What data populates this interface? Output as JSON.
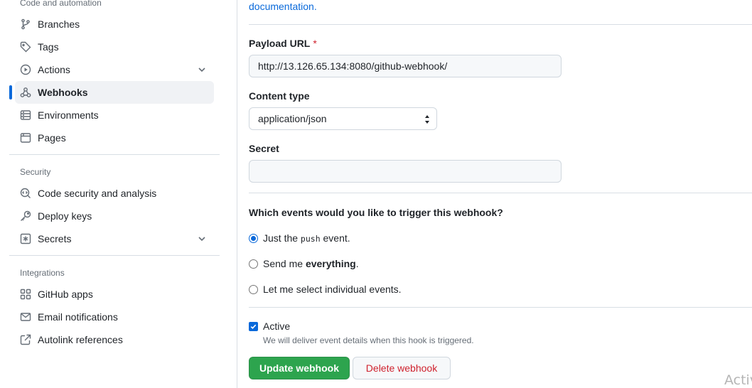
{
  "sidebar": {
    "code_section": "Code and automation",
    "code_items": [
      {
        "label": "Branches",
        "icon": "branch-icon"
      },
      {
        "label": "Tags",
        "icon": "tag-icon"
      },
      {
        "label": "Actions",
        "icon": "play-icon"
      },
      {
        "label": "Webhooks",
        "icon": "webhook-icon",
        "active": true
      },
      {
        "label": "Environments",
        "icon": "server-icon"
      },
      {
        "label": "Pages",
        "icon": "browser-icon"
      }
    ],
    "security_section": "Security",
    "security_items": [
      {
        "label": "Code security and analysis",
        "icon": "codescan-icon"
      },
      {
        "label": "Deploy keys",
        "icon": "key-icon"
      },
      {
        "label": "Secrets",
        "icon": "asterisk-icon"
      }
    ],
    "integrations_section": "Integrations",
    "integrations_items": [
      {
        "label": "GitHub apps",
        "icon": "apps-icon"
      },
      {
        "label": "Email notifications",
        "icon": "mail-icon"
      },
      {
        "label": "Autolink references",
        "icon": "link-external-icon"
      }
    ]
  },
  "main": {
    "doc_link": "documentation",
    "doc_link_tail": ".",
    "payload_label": "Payload URL",
    "required_mark": "*",
    "payload_value": "http://13.126.65.134:8080/github-webhook/",
    "content_type_label": "Content type",
    "content_type_value": "application/json",
    "secret_label": "Secret",
    "secret_value": "",
    "events_question": "Which events would you like to trigger this webhook?",
    "option_push_prefix": "Just the",
    "option_push_code": "push",
    "option_push_suffix": "event.",
    "option_everything_prefix": "Send me",
    "option_everything_bold": "everything",
    "option_everything_suffix": ".",
    "option_individual": "Let me select individual events.",
    "active_label": "Active",
    "active_hint": "We will deliver event details when this hook is triggered.",
    "update_button": "Update webhook",
    "delete_button": "Delete webhook"
  },
  "overlay": {
    "watermark": "Activ"
  },
  "colors": {
    "accent": "#0969da",
    "primary_button": "#2da44e",
    "danger": "#cf222e",
    "muted": "#656d76"
  }
}
